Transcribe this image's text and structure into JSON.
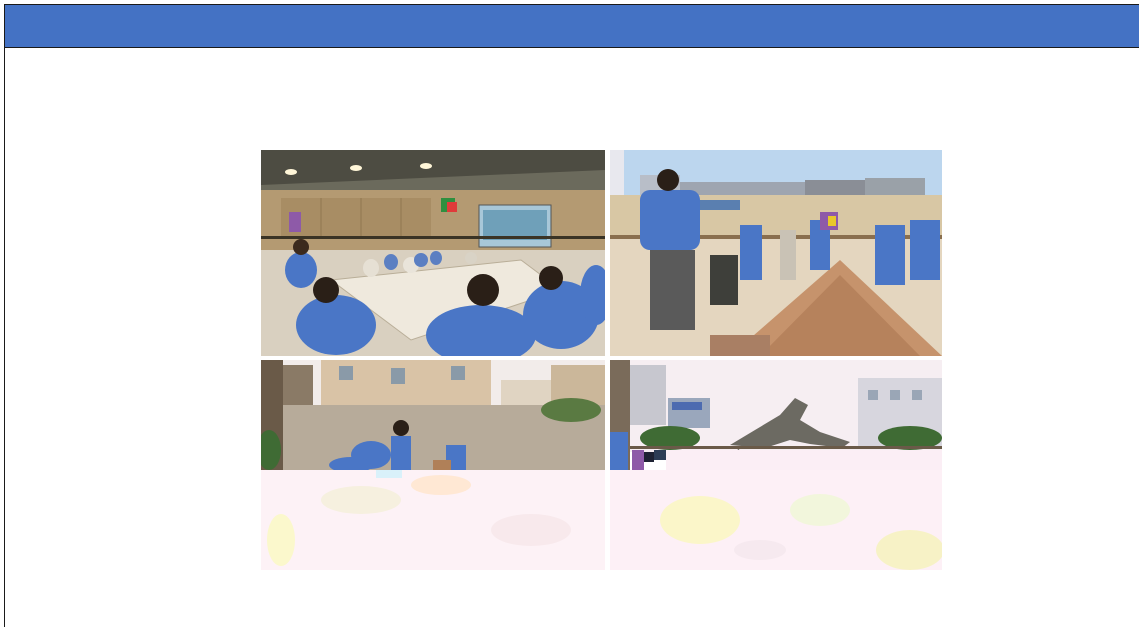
{
  "slide": {
    "title": "",
    "header_color": "#4472c4"
  },
  "photos": [
    {
      "id": "meeting-room",
      "content": "photo"
    },
    {
      "id": "sand-pile-work",
      "content": "photo"
    },
    {
      "id": "wall-yard-work",
      "content": "photo"
    },
    {
      "id": "horse-statue",
      "content": "photo"
    }
  ]
}
